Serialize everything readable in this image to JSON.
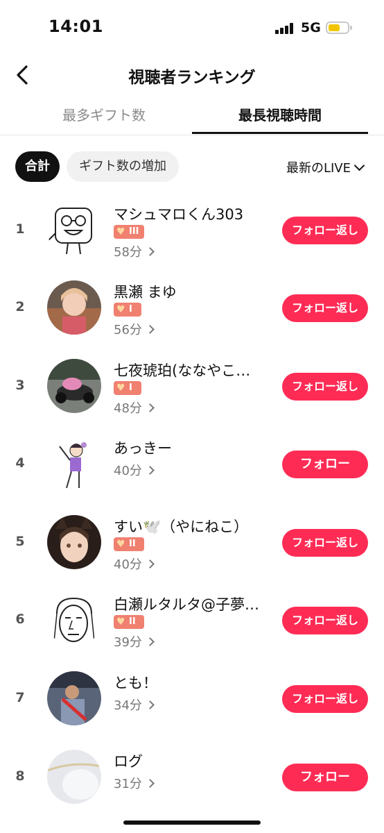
{
  "status": {
    "time": "14:01",
    "network": "5G"
  },
  "header": {
    "title": "視聴者ランキング"
  },
  "tabs": [
    {
      "label": "最多ギフト数",
      "active": false
    },
    {
      "label": "最長視聴時間",
      "active": true
    }
  ],
  "filters": {
    "total": "合計",
    "gift_increase": "ギフト数の増加",
    "live_select": "最新のLIVE"
  },
  "viewers": [
    {
      "rank": "1",
      "name": "マシュマロくん303",
      "badge": "III",
      "duration": "58分",
      "button": "フォロー返し"
    },
    {
      "rank": "2",
      "name": "黒瀬 まゆ",
      "badge": "I",
      "duration": "56分",
      "button": "フォロー返し"
    },
    {
      "rank": "3",
      "name": "七夜琥珀(ななやこ…",
      "badge": "I",
      "duration": "48分",
      "button": "フォロー返し"
    },
    {
      "rank": "4",
      "name": "あっきー",
      "badge": "",
      "duration": "40分",
      "button": "フォロー"
    },
    {
      "rank": "5",
      "name": "すい🕊️（やにねこ）",
      "badge": "II",
      "duration": "40分",
      "button": "フォロー返し"
    },
    {
      "rank": "6",
      "name": "白瀬ルタルタ@子夢…",
      "badge": "II",
      "duration": "39分",
      "button": "フォロー返し"
    },
    {
      "rank": "7",
      "name": "とも！",
      "badge": "",
      "duration": "34分",
      "button": "フォロー返し"
    },
    {
      "rank": "8",
      "name": "ログ",
      "badge": "",
      "duration": "31分",
      "button": "フォロー"
    }
  ],
  "colors": {
    "accent": "#fe2c55",
    "badge": "#f08070",
    "battery": "#f2c500"
  }
}
